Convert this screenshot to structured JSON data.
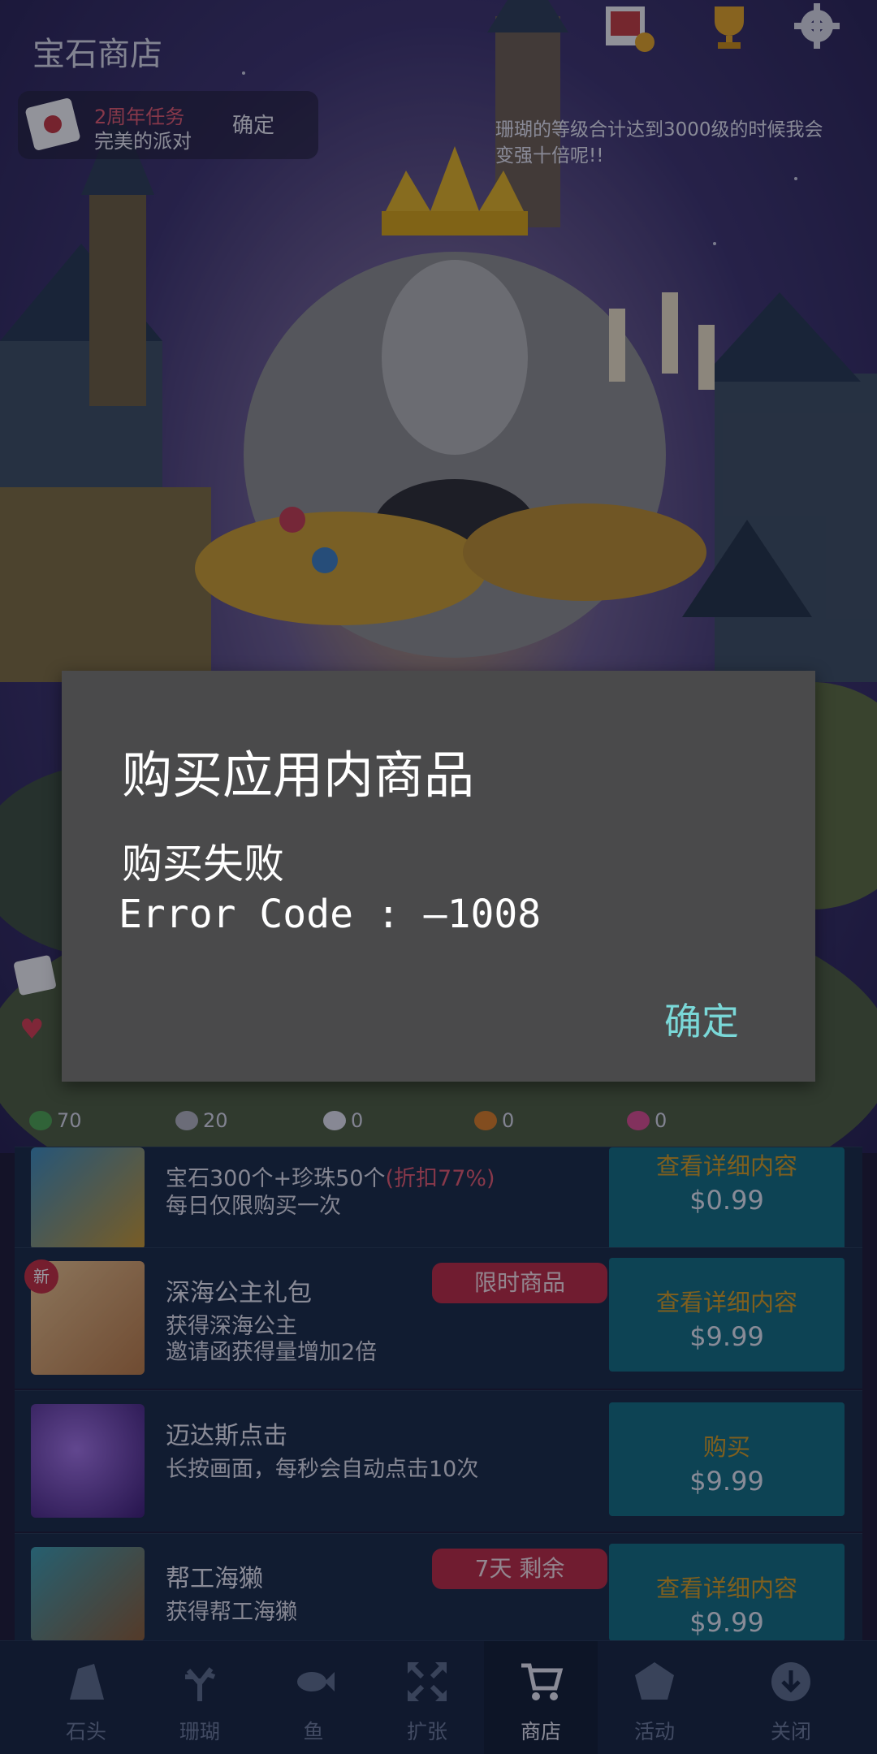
{
  "header": {
    "title": "宝石商店"
  },
  "mission": {
    "tag": "2周年任务",
    "name": "完美的派对",
    "confirm": "确定"
  },
  "hint": "珊瑚的等级合计达到3000级的时候我会变强十倍呢!!",
  "stats": [
    "70",
    "20",
    "0",
    "0",
    "0"
  ],
  "shop": {
    "items": [
      {
        "title": "",
        "desc_main": "宝石300个+珍珠50个",
        "desc_discount": "(折扣77%)",
        "desc2": "每日仅限购买一次",
        "tag": "",
        "button_top": "查看详细内容",
        "price": "$0.99",
        "is_new": false
      },
      {
        "title": "深海公主礼包",
        "desc_main": "获得深海公主",
        "desc_discount": "",
        "desc2": "邀请函获得量增加2倍",
        "tag": "限时商品",
        "button_top": "查看详细内容",
        "price": "$9.99",
        "is_new": true,
        "new_label": "新"
      },
      {
        "title": "迈达斯点击",
        "desc_main": "长按画面，每秒会自动点击10次",
        "desc_discount": "",
        "desc2": "",
        "tag": "",
        "button_top": "购买",
        "price": "$9.99",
        "is_new": false
      },
      {
        "title": "帮工海獭",
        "desc_main": "获得帮工海獭",
        "desc_discount": "",
        "desc2": "",
        "tag": "7天 剩余",
        "button_top": "查看详细内容",
        "price": "$9.99",
        "is_new": false
      }
    ]
  },
  "nav": {
    "items": [
      {
        "label": "石头",
        "icon": "stone-icon"
      },
      {
        "label": "珊瑚",
        "icon": "coral-icon"
      },
      {
        "label": "鱼",
        "icon": "fish-icon"
      },
      {
        "label": "扩张",
        "icon": "expand-icon"
      },
      {
        "label": "商店",
        "icon": "cart-icon",
        "active": true
      },
      {
        "label": "活动",
        "icon": "event-icon"
      },
      {
        "label": "关闭",
        "icon": "close-download-icon"
      }
    ]
  },
  "dialog": {
    "title": "购买应用内商品",
    "message": "购买失败",
    "error": "Error Code : —1008",
    "ok": "确定"
  },
  "colors": {
    "accent_teal": "#7ad8d8",
    "button_bg": "#0f6a7a",
    "tag_red": "#b8273d",
    "dialog_bg": "#4a4a4b"
  }
}
